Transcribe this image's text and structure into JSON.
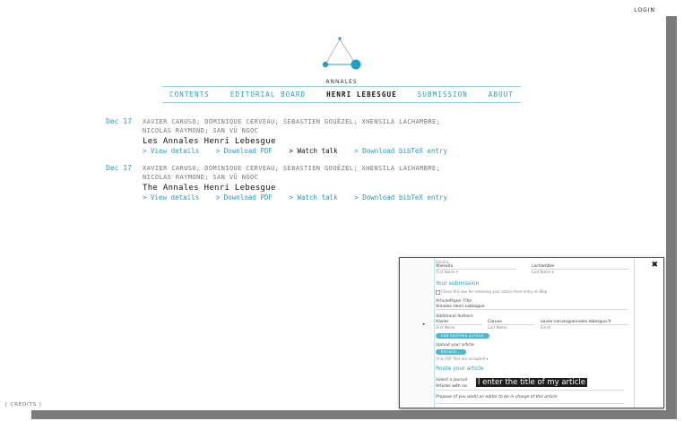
{
  "header": {
    "login": "LOGIN"
  },
  "brand": {
    "name": "ANNALES"
  },
  "nav": [
    {
      "label": "CONTENTS",
      "active": false
    },
    {
      "label": "EDITORIAL BOARD",
      "active": false
    },
    {
      "label": "HENRI LEBESGUE",
      "active": true
    },
    {
      "label": "SUBMISSION",
      "active": false
    },
    {
      "label": "ABOUT",
      "active": false
    }
  ],
  "entries": [
    {
      "date": "Dec 17",
      "authors_line1": "XAVIER CARUSO; DOMINIQUE CERVEAU; SÉBASTIEN GOUËZEL; XHENSILA LACHAMBRE;",
      "authors_line2": "NICOLAS RAYMOND; SAN VŨ NGỌC",
      "title": "Les Annales Henri Lebesgue",
      "links": [
        "> View details",
        "> Download PDF",
        "> Watch talk",
        "> Download bibTeX entry"
      ]
    },
    {
      "date": "Dec 17",
      "authors_line1": "XAVIER CARUSO; DOMINIQUE CERVEAU; SÉBASTIEN GOUËZEL; XHENSILA LACHAMBRE;",
      "authors_line2": "NICOLAS RAYMOND; SAN VŨ NGỌC",
      "title": "The Annales Henri Lebesgue",
      "links": [
        "> View details",
        "> Download PDF",
        "> Watch talk",
        "> Download bibTeX entry"
      ]
    }
  ],
  "footer": {
    "credits": "[ CREDITS ]"
  },
  "popup": {
    "close": "✖",
    "email_label": "Email ▾",
    "first_name_value": "Xhensila",
    "last_name_value": "Lachambre",
    "first_name_label": "First Name ▾",
    "last_name_label": "Last Name ▾",
    "submission_header": "Your submission",
    "consent_text": "Check this box for releasing your article from entry on Map",
    "article_title_label": "Article/Paper Title",
    "article_title_value": "Annales Henri Lebesgue",
    "additional_authors_label": "Additional Authors",
    "author_first": "Xavier",
    "author_last": "Caruso",
    "author_email": "xavier.caruso@annales.lebesgue.fr",
    "author_first_label": "First Name",
    "author_last_label": "Last Name",
    "author_email_label": "Email",
    "add_author_button": "ADD ANOTHER AUTHOR",
    "upload_label": "Upload your article",
    "browse_button": "BROWSE...",
    "upload_hint": "Only PDF files are accepted ▾",
    "route_header": "Route your article",
    "journal_label": "Select a journal",
    "journal_sub": "Articles with no",
    "propose_label": "Propose (if you wish) an editor to be in charge of this article",
    "tooltip": "l enter the title of my article"
  }
}
